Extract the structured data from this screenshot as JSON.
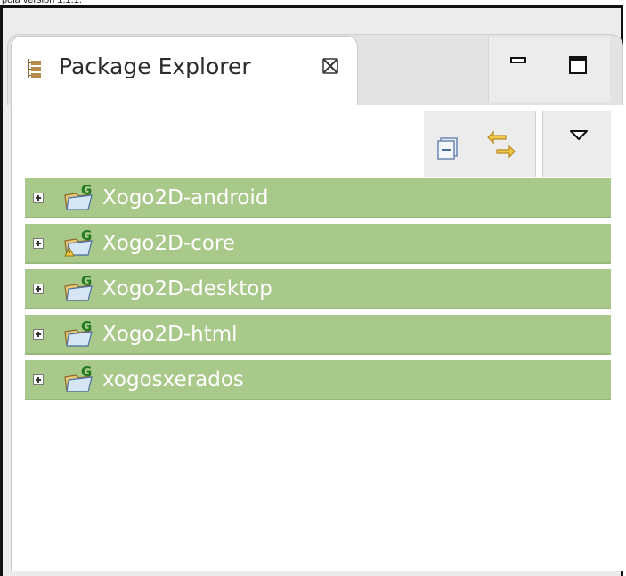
{
  "caption": "pola versión 1.1.1.",
  "view": {
    "title": "Package Explorer",
    "tab_icon": "package-explorer-icon",
    "close_icon": "close-icon"
  },
  "window_buttons": [
    {
      "name": "minimize-button",
      "icon": "minimize-icon"
    },
    {
      "name": "maximize-button",
      "icon": "maximize-icon"
    }
  ],
  "toolbar": {
    "collapse_all_icon": "collapse-all-icon",
    "link_with_editor_icon": "link-with-editor-icon",
    "view_menu_icon": "view-menu-chevron-down-icon"
  },
  "tree": {
    "selection_color": "#a9c98a",
    "items": [
      {
        "label": "Xogo2D-android",
        "warning": false
      },
      {
        "label": "Xogo2D-core",
        "warning": true
      },
      {
        "label": "Xogo2D-desktop",
        "warning": false
      },
      {
        "label": "Xogo2D-html",
        "warning": false
      },
      {
        "label": "xogosxerados",
        "warning": false
      }
    ]
  }
}
